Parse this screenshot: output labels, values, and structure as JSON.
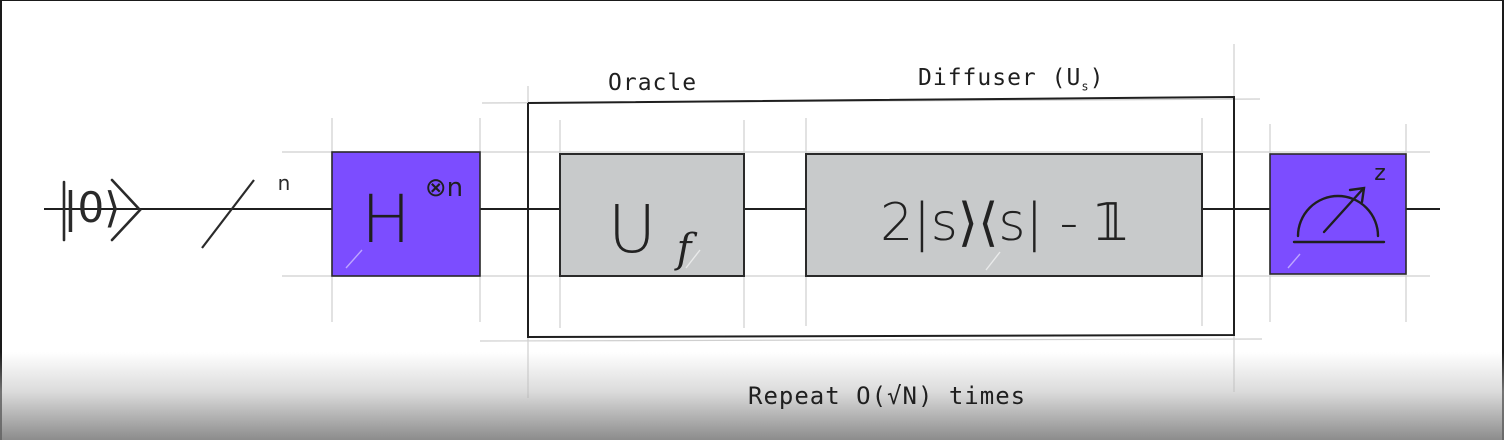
{
  "diagram": {
    "input_state": "|0⟩",
    "register_size": "n",
    "hadamard": {
      "base": "H",
      "superscript": "⊗n"
    },
    "oracle": {
      "title": "Oracle",
      "gate_base": "U",
      "gate_sub": "f"
    },
    "diffuser": {
      "title": "Diffuser (U",
      "title_sub": "s",
      "title_close": ")",
      "formula": "2|s⟩⟨s| - 𝟙"
    },
    "measurement": {
      "basis": "z"
    },
    "repeat_caption": "Repeat O(√N) times"
  },
  "colors": {
    "hadamard_fill": "#7c4dff",
    "measure_fill": "#7c4dff",
    "gate_fill": "#c8cacb",
    "ink": "#1f1f1f",
    "guide": "#c9c9c9"
  }
}
